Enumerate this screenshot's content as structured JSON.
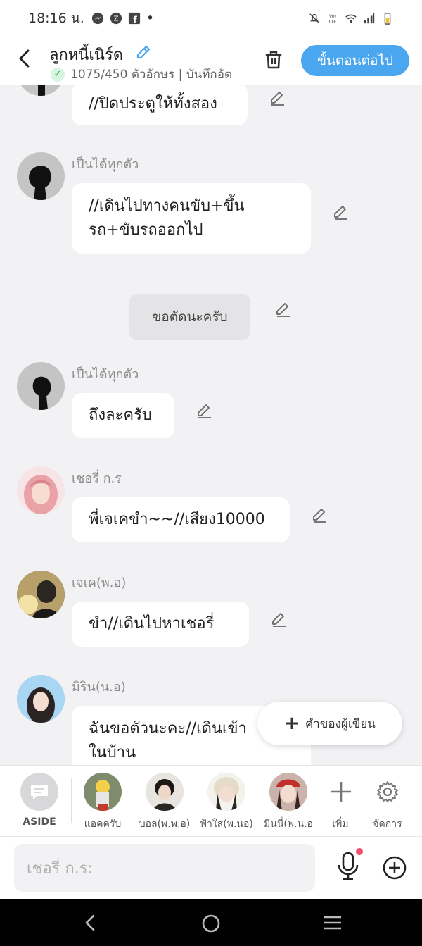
{
  "status": {
    "time": "18:16 น.",
    "icons_left": [
      "messenger-icon",
      "messenger-alt-icon",
      "facebook-icon",
      "dot"
    ],
    "icons_right": [
      "mute-icon",
      "volte-icon",
      "wifi-icon",
      "signal-icon",
      "battery-icon"
    ]
  },
  "header": {
    "title": "ลูกหนี้เนิร์ด",
    "count": "1075/450 ตัวอักษร | บันทึกอัต",
    "next_label": "ขั้นตอนต่อไป"
  },
  "messages": [
    {
      "name": "",
      "text": "//ปิดประตูให้ทั้งสอง"
    },
    {
      "name": "เป็นได้ทุกตัว",
      "text": "//เดินไปทางคนขับ+ขึ้น\nรถ+ขับรถออกไป"
    },
    {
      "system": "ขอตัดนะครับ"
    },
    {
      "name": "เป็นได้ทุกตัว",
      "text": "ถึงละครับ"
    },
    {
      "name": "เชอรี่ ก.ร",
      "text": "พี่เจเคขำ~~//เสียง10000"
    },
    {
      "name": "เจเค(พ.อ)",
      "text": "ขำ//เดินไปหาเชอรี่"
    },
    {
      "name": "มิริน(น.อ)",
      "text": "ฉันขอตัวนะคะ//เดินเข้า\nในบ้าน"
    }
  ],
  "fab": {
    "label": "คำของผู้เขียน"
  },
  "charbar": {
    "aside": "ASIDE",
    "chars": [
      "แอคครับ",
      "บอล(พ.พ.อ)",
      "ฟ้าใส(พ.นอ)",
      "มินนี่(พ.น.อ"
    ],
    "add": "เพิ่ม",
    "manage": "จัดการ"
  },
  "input": {
    "placeholder": "เชอรี่ ก.ร:"
  },
  "colors": {
    "accent": "#4aa6ee",
    "background": "#f2f2f4",
    "record_dot": "#f0506e"
  }
}
